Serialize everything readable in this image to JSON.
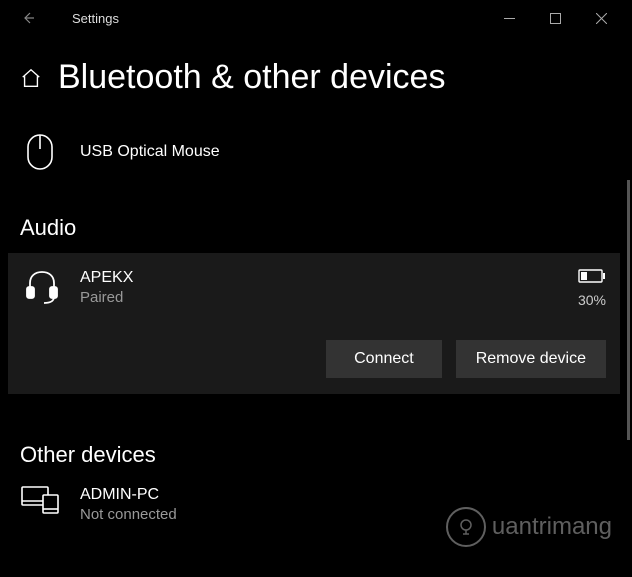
{
  "titlebar": {
    "app_title": "Settings"
  },
  "page": {
    "title": "Bluetooth & other devices"
  },
  "mouse_section": {
    "device_name": "USB Optical Mouse"
  },
  "audio_section": {
    "title": "Audio",
    "device_name": "APEKX",
    "status": "Paired",
    "battery_pct": "30%",
    "connect_label": "Connect",
    "remove_label": "Remove device"
  },
  "other_section": {
    "title": "Other devices",
    "device_name": "ADMIN-PC",
    "status": "Not connected"
  },
  "watermark": {
    "text": "uantrimang"
  }
}
